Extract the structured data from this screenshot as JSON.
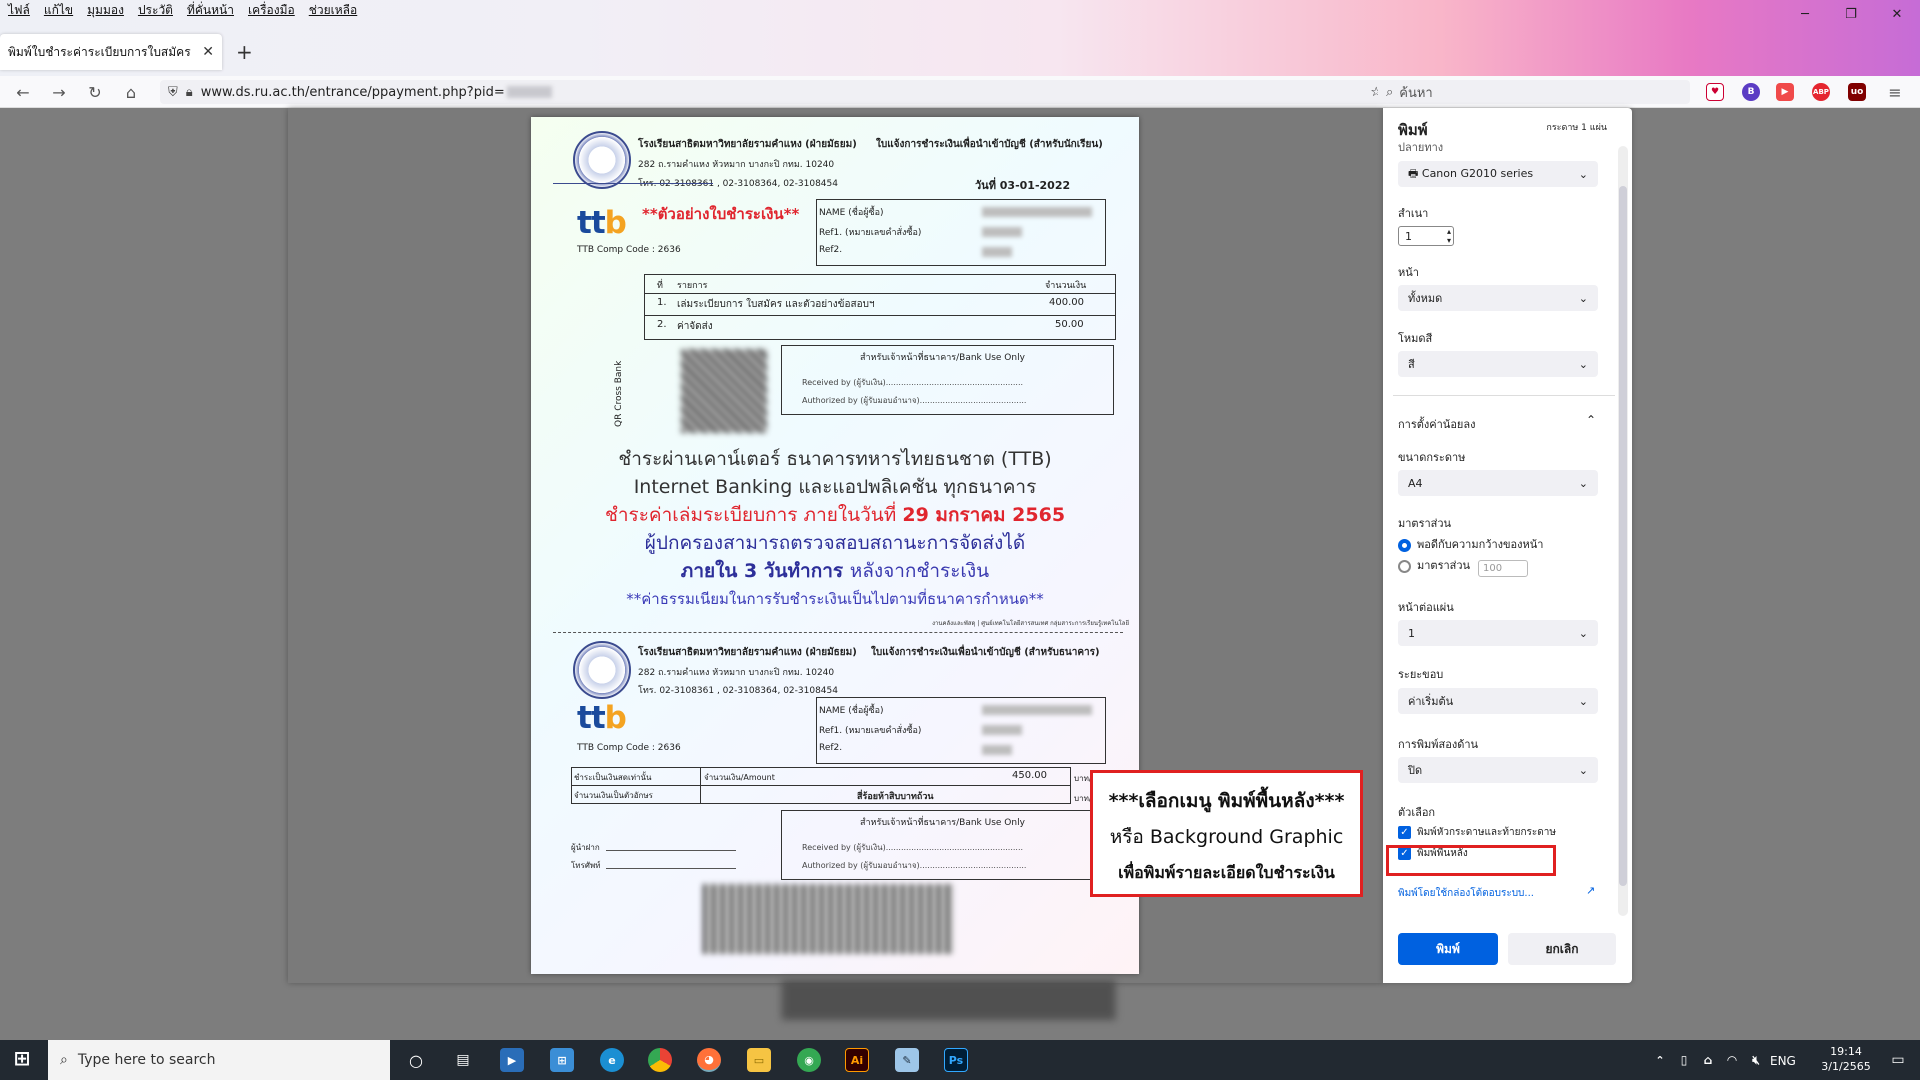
{
  "menu": [
    "ไฟล์",
    "แก้ไข",
    "มุมมอง",
    "ประวัติ",
    "ที่คั่นหน้า",
    "เครื่องมือ",
    "ช่วยเหลือ"
  ],
  "tab": {
    "title": "พิมพ์ใบชำระค่าระเบียบการใบสมัคร",
    "close": "✕",
    "new": "+"
  },
  "nav": {
    "url": "www.ds.ru.ac.th/entrance/ppayment.php?pid=",
    "search_placeholder": "ค้นหา"
  },
  "doc": {
    "school": "โรงเรียนสาธิตมหาวิทยาลัยรามคำแหง (ฝ่ายมัธยม)",
    "addr": "282 ถ.รามคำแหง หัวหมาก บางกะปิ กทม. 10240",
    "tel": "โทร. 02-3108361 , 02-3108364, 02-3108454",
    "form_title": "ใบแจ้งการชำระเงินเพื่อนำเข้าบัญชี (สำหรับนักเรียน)",
    "form_title_bank": "ใบแจ้งการชำระเงินเพื่อนำเข้าบัญชี (สำหรับธนาคาร)",
    "date": "วันที่ 03-01-2022",
    "sample": "**ตัวอย่างใบชำระเงิน**",
    "ttb_comp": "TTB Comp Code : 2636",
    "name_lbl": "NAME (ชื่อผู้ซื้อ)",
    "ref1_lbl": "Ref1. (หมายเลขคำสั่งซื้อ)",
    "ref2_lbl": "Ref2.",
    "col_no": "ที่",
    "col_item": "รายการ",
    "col_amount": "จำนวนเงิน",
    "items": [
      {
        "no": "1.",
        "name": "เล่มระเบียบการ ใบสมัคร และตัวอย่างข้อสอบฯ",
        "amount": "400.00"
      },
      {
        "no": "2.",
        "name": "ค่าจัดส่ง",
        "amount": "50.00"
      }
    ],
    "qr_label": "QR Cross Bank",
    "bank_use": "สำหรับเจ้าหน้าที่ธนาคาร/Bank Use Only",
    "received": "Received by (ผู้รับเงิน)......................................................",
    "authorized": "Authorized by (ผู้รับมอบอำนาจ)..........................................",
    "line1": "ชำระผ่านเคาน์เตอร์ ธนาคารทหารไทยธนชาต (TTB)",
    "line2": "Internet Banking และแอปพลิเคชัน ทุกธนาคาร",
    "line3a": "ชำระค่าเล่มระเบียบการ ภายในวันที่ ",
    "line3b": "29 มกราคม 2565",
    "line4": "ผู้ปกครองสามารถตรวจสอบสถานะการจัดส่งได้",
    "line5a": "ภายใน 3 วันทำการ ",
    "line5b": "หลังจากชำระเงิน",
    "line6": "**ค่าธรรมเนียมในการรับชำระเงินเป็นไปตามที่ธนาคารกำหนด**",
    "footer_small": "งานคลังและพัสดุ | ศูนย์เทคโนโลยีสารสนเทศ กลุ่มสาระการเรียนรู้เทคโนโลยี",
    "cash_only": "ชำระเป็นเงินสดเท่านั้น",
    "amount_lbl": "จำนวนเงิน/Amount",
    "amount_val": "450.00",
    "baht": "บาท/Baht",
    "amount_text_lbl": "จำนวนเงินเป็นตัวอักษร",
    "amount_text": "สี่ร้อยห้าสิบบาทถ้วน",
    "payer": "ผู้นำฝาก",
    "phone": "โทรศัพท์"
  },
  "print": {
    "title": "พิมพ์",
    "sheets": "กระดาษ 1 แผ่น",
    "printer_lbl": "ปลายทาง",
    "printer": "Canon G2010 series",
    "copies_lbl": "สำเนา",
    "copies": "1",
    "pages_lbl": "หน้า",
    "pages": "ทั้งหมด",
    "mode_lbl": "โหมดสี",
    "mode": "สี",
    "more_lbl": "การตั้งค่าน้อยลง",
    "paper_lbl": "ขนาดกระดาษ",
    "paper": "A4",
    "scale_lbl": "มาตราส่วน",
    "scale_fit": "พอดีกับความกว้างของหน้า",
    "scale_custom": "มาตราส่วน",
    "scale_val": "100",
    "pps_lbl": "หน้าต่อแผ่น",
    "pps": "1",
    "margins_lbl": "ระยะขอบ",
    "margins": "ค่าเริ่มต้น",
    "duplex_lbl": "การพิมพ์สองด้าน",
    "duplex": "ปิด",
    "options_lbl": "ตัวเลือก",
    "opt_headers": "พิมพ์หัวกระดาษและท้ายกระดาษ",
    "opt_bg": "พิมพ์พื้นหลัง",
    "system_dialog": "พิมพ์โดยใช้กล่องโต้ตอบระบบ...",
    "print_btn": "พิมพ์",
    "cancel_btn": "ยกเลิก"
  },
  "callout": {
    "l1": "***เลือกเมนู พิมพ์พื้นหลัง***",
    "l2": "หรือ Background Graphic",
    "l3": "เพื่อพิมพ์รายละเอียดใบชำระเงิน"
  },
  "taskbar": {
    "search": "Type here to search",
    "lang": "ENG",
    "time": "19:14",
    "date": "3/1/2565"
  },
  "colors": {
    "accent": "#0061e0",
    "highlight": "#e02020",
    "ttb_blue": "#1a4a9c",
    "ttb_orange": "#f4a321"
  }
}
